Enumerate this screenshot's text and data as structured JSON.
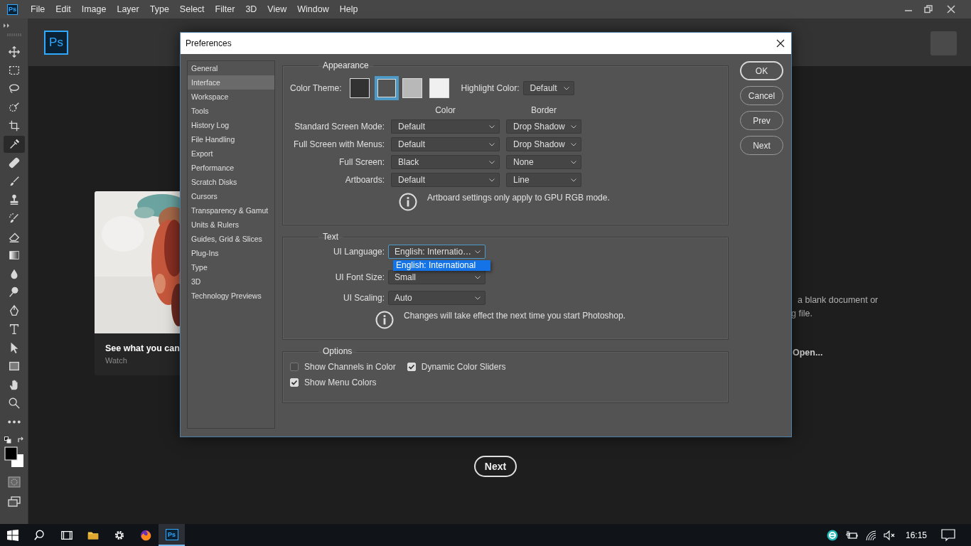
{
  "menu_bar": {
    "logo": "Ps",
    "items": [
      "File",
      "Edit",
      "Image",
      "Layer",
      "Type",
      "Select",
      "Filter",
      "3D",
      "View",
      "Window",
      "Help"
    ]
  },
  "tools": [
    {
      "kind": "move",
      "selected": false
    },
    {
      "kind": "marquee",
      "selected": false
    },
    {
      "kind": "lasso",
      "selected": false
    },
    {
      "kind": "quick",
      "selected": false
    },
    {
      "kind": "crop",
      "selected": false
    },
    {
      "kind": "eyedropper",
      "selected": true
    },
    {
      "kind": "bandage",
      "selected": false
    },
    {
      "kind": "brush",
      "selected": false
    },
    {
      "kind": "stamp",
      "selected": false
    },
    {
      "kind": "history",
      "selected": false
    },
    {
      "kind": "eraser",
      "selected": false
    },
    {
      "kind": "gradient",
      "selected": false
    },
    {
      "kind": "drop",
      "selected": false
    },
    {
      "kind": "dodge",
      "selected": false
    },
    {
      "kind": "pen",
      "selected": false
    },
    {
      "kind": "type",
      "selected": false
    },
    {
      "kind": "pointer",
      "selected": false
    },
    {
      "kind": "rectangle",
      "selected": false
    },
    {
      "kind": "hand",
      "selected": false
    },
    {
      "kind": "zoom",
      "selected": false
    },
    {
      "kind": "more",
      "selected": false
    }
  ],
  "home": {
    "logo": "Ps",
    "card": {
      "title": "See what you can",
      "subtitle": "Watch"
    },
    "side_text": [
      "a blank document or",
      "g file."
    ],
    "open_link": "Open...",
    "next_button": "Next"
  },
  "dialog": {
    "title": "Preferences",
    "categories": [
      {
        "label": "General",
        "selected": false
      },
      {
        "label": "Interface",
        "selected": true
      },
      {
        "label": "Workspace",
        "selected": false
      },
      {
        "label": "Tools",
        "selected": false
      },
      {
        "label": "History Log",
        "selected": false
      },
      {
        "label": "File Handling",
        "selected": false
      },
      {
        "label": "Export",
        "selected": false
      },
      {
        "label": "Performance",
        "selected": false
      },
      {
        "label": "Scratch Disks",
        "selected": false
      },
      {
        "label": "Cursors",
        "selected": false
      },
      {
        "label": "Transparency & Gamut",
        "selected": false
      },
      {
        "label": "Units & Rulers",
        "selected": false
      },
      {
        "label": "Guides, Grid & Slices",
        "selected": false
      },
      {
        "label": "Plug-Ins",
        "selected": false
      },
      {
        "label": "Type",
        "selected": false
      },
      {
        "label": "3D",
        "selected": false
      },
      {
        "label": "Technology Previews",
        "selected": false
      }
    ],
    "appearance": {
      "legend": "Appearance",
      "color_theme_label": "Color Theme:",
      "themes": [
        {
          "color": "#323232",
          "selected": false
        },
        {
          "color": "#535353",
          "selected": true
        },
        {
          "color": "#b8b8b8",
          "selected": false
        },
        {
          "color": "#f0f0f0",
          "selected": false
        }
      ],
      "highlight_label": "Highlight Color:",
      "highlight_value": "Default",
      "column_headers": [
        "Color",
        "Border"
      ],
      "rows": [
        {
          "label": "Standard Screen Mode:",
          "color_value": "Default",
          "border_value": "Drop Shadow"
        },
        {
          "label": "Full Screen with Menus:",
          "color_value": "Default",
          "border_value": "Drop Shadow"
        },
        {
          "label": "Full Screen:",
          "color_value": "Black",
          "border_value": "None"
        },
        {
          "label": "Artboards:",
          "color_value": "Default",
          "border_value": "Line"
        }
      ],
      "note": "Artboard settings only apply to GPU RGB mode."
    },
    "text": {
      "legend": "Text",
      "fields": [
        {
          "label": "UI Language:",
          "value": "English: Internatio…",
          "focused": true
        },
        {
          "label": "UI Font Size:",
          "value": "Small",
          "focused": false
        },
        {
          "label": "UI Scaling:",
          "value": "Auto",
          "focused": false
        }
      ],
      "language_options": [
        {
          "label": "English: International",
          "selected": true
        }
      ],
      "note": "Changes will take effect the next time you start Photoshop."
    },
    "options": {
      "legend": "Options",
      "checkboxes": [
        {
          "label": "Show Channels in Color",
          "checked": false
        },
        {
          "label": "Dynamic Color Sliders",
          "checked": true
        },
        {
          "label": "Show Menu Colors",
          "checked": true
        }
      ]
    },
    "buttons": [
      {
        "label": "OK",
        "default": true
      },
      {
        "label": "Cancel",
        "default": false
      },
      {
        "label": "Prev",
        "default": false
      },
      {
        "label": "Next",
        "default": false
      }
    ]
  },
  "taskbar": {
    "apps": [
      {
        "kind": "search",
        "active": false
      },
      {
        "kind": "taskview",
        "active": false
      },
      {
        "kind": "folder",
        "active": false
      },
      {
        "kind": "gear",
        "active": false
      },
      {
        "kind": "browser",
        "active": false
      },
      {
        "kind": "photoshop",
        "label": "Ps",
        "active": true
      }
    ],
    "clock": "16:15"
  }
}
